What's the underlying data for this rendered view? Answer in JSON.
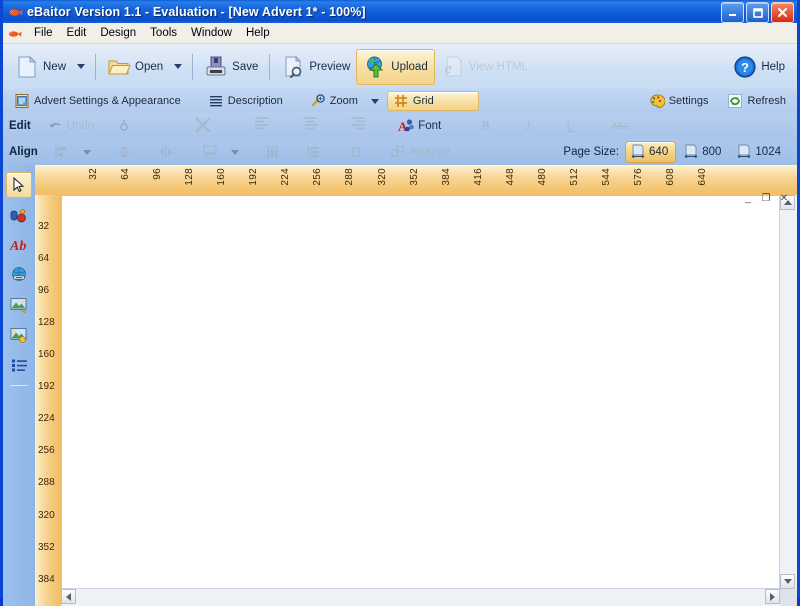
{
  "window": {
    "title": "eBaitor Version 1.1 - Evaluation - [New Advert 1* - 100%]",
    "app_icon": "fish-icon",
    "minimize_label": "Minimize",
    "maximize_label": "Maximize",
    "close_label": "Close",
    "mdi_minimize": "_",
    "mdi_restore": "❐",
    "mdi_close": "✕"
  },
  "menu": {
    "icon": "fish-icon",
    "items": [
      {
        "label": "File"
      },
      {
        "label": "Edit"
      },
      {
        "label": "Design"
      },
      {
        "label": "Tools"
      },
      {
        "label": "Window"
      },
      {
        "label": "Help"
      }
    ]
  },
  "toolbar_main": {
    "new": {
      "label": "New",
      "icon": "new-page-icon",
      "has_dropdown": true,
      "enabled": true
    },
    "open": {
      "label": "Open",
      "icon": "open-folder-icon",
      "has_dropdown": true,
      "enabled": true
    },
    "save": {
      "label": "Save",
      "icon": "floppy-disk-icon",
      "enabled": true
    },
    "preview": {
      "label": "Preview",
      "icon": "page-magnifier-icon",
      "enabled": true
    },
    "upload": {
      "label": "Upload",
      "icon": "globe-upload-icon",
      "enabled": true,
      "highlighted": true
    },
    "view_html": {
      "label": "View HTML",
      "icon": "internet-explorer-icon",
      "enabled": false
    },
    "help": {
      "label": "Help",
      "icon": "question-mark-icon",
      "enabled": true
    }
  },
  "toolbar_design": {
    "advert_settings": {
      "label": "Advert Settings & Appearance",
      "icon": "clipboard-settings-icon"
    },
    "description": {
      "label": "Description",
      "icon": "lines-icon"
    },
    "zoom": {
      "label": "Zoom",
      "icon": "magnifier-plus-icon",
      "has_dropdown": true
    },
    "grid": {
      "label": "Grid",
      "icon": "grid-icon",
      "active": true
    },
    "settings": {
      "label": "Settings",
      "icon": "palette-icon"
    },
    "refresh": {
      "label": "Refresh",
      "icon": "refresh-icon"
    }
  },
  "toolbar_edit": {
    "group_label": "Edit",
    "undo": {
      "label": "Undo",
      "icon": "undo-icon",
      "enabled": false
    },
    "redo": {
      "label": "Redo",
      "icon": "redo-icon",
      "enabled": false
    },
    "delete": {
      "label": "Delete",
      "icon": "x-delete-icon",
      "enabled": false
    },
    "align_left": {
      "label": "Align Left",
      "icon": "align-left-icon",
      "enabled": false
    },
    "align_center": {
      "label": "Align Center",
      "icon": "align-center-icon",
      "enabled": false
    },
    "align_right": {
      "label": "Align Right",
      "icon": "align-right-icon",
      "enabled": false
    },
    "font": {
      "label": "Font",
      "icon": "font-color-icon",
      "enabled": true
    },
    "bold": {
      "label": "B",
      "icon": "bold-icon",
      "enabled": false
    },
    "italic": {
      "label": "I",
      "icon": "italic-icon",
      "enabled": false
    },
    "underline": {
      "label": "U",
      "icon": "underline-icon",
      "enabled": false
    },
    "strikethrough": {
      "label": "ABC",
      "icon": "strikethrough-icon",
      "enabled": false
    }
  },
  "toolbar_align": {
    "group_label": "Align",
    "align_edges": {
      "label": "Align Edges",
      "icon": "align-edges-icon",
      "has_dropdown": true,
      "enabled": false
    },
    "center_vertical": {
      "label": "Center Vertically",
      "icon": "center-vertical-icon",
      "enabled": false
    },
    "center_horizontal": {
      "label": "Center Horizontally",
      "icon": "center-horizontal-icon",
      "enabled": false
    },
    "size": {
      "label": "Size",
      "icon": "resize-icon",
      "has_dropdown": true,
      "enabled": false
    },
    "space_across": {
      "label": "Space Across",
      "icon": "space-across-icon",
      "enabled": false
    },
    "space_down": {
      "label": "Space Down",
      "icon": "space-down-icon",
      "enabled": false
    },
    "nudge": {
      "label": "Nudge",
      "icon": "nudge-icon",
      "enabled": false
    },
    "arrange": {
      "label": "Arrange",
      "icon": "arrange-icon",
      "enabled": false
    }
  },
  "page_size": {
    "label": "Page Size:",
    "options": [
      {
        "value": "640",
        "selected": true
      },
      {
        "value": "800",
        "selected": false
      },
      {
        "value": "1024",
        "selected": false
      }
    ]
  },
  "left_tools": [
    {
      "name": "pointer-tool",
      "icon": "cursor-arrow-icon",
      "selected": true
    },
    {
      "name": "shapes-tool",
      "icon": "shapes-icon",
      "selected": false
    },
    {
      "name": "text-tool",
      "icon": "text-ab-icon",
      "selected": false
    },
    {
      "name": "link-tool",
      "icon": "globe-link-icon",
      "selected": false
    },
    {
      "name": "image-tool",
      "icon": "picture-star-icon",
      "selected": false
    },
    {
      "name": "gallery-tool",
      "icon": "picture-gallery-icon",
      "selected": false
    },
    {
      "name": "list-tool",
      "icon": "bullet-list-icon",
      "selected": false
    }
  ],
  "rulers": {
    "unit_step": 32,
    "horizontal_ticks": [
      32,
      64,
      96,
      128,
      160,
      192,
      224,
      256,
      288,
      320,
      352,
      384,
      416,
      448,
      480,
      512,
      544,
      576,
      608,
      640
    ],
    "vertical_ticks": [
      32,
      64,
      96,
      128,
      160,
      192,
      224,
      256,
      288,
      320,
      352,
      384
    ]
  },
  "canvas": {
    "background": "#ffffff",
    "zoom": "100%",
    "document_name": "New Advert 1*"
  },
  "colors": {
    "title_blue": "#0a4fcf",
    "highlight_orange": "#f3d48b",
    "ruler_orange": "#f4c877",
    "toolbar_blue": "#cfe0f5",
    "menu_bg": "#f1f0e8"
  }
}
